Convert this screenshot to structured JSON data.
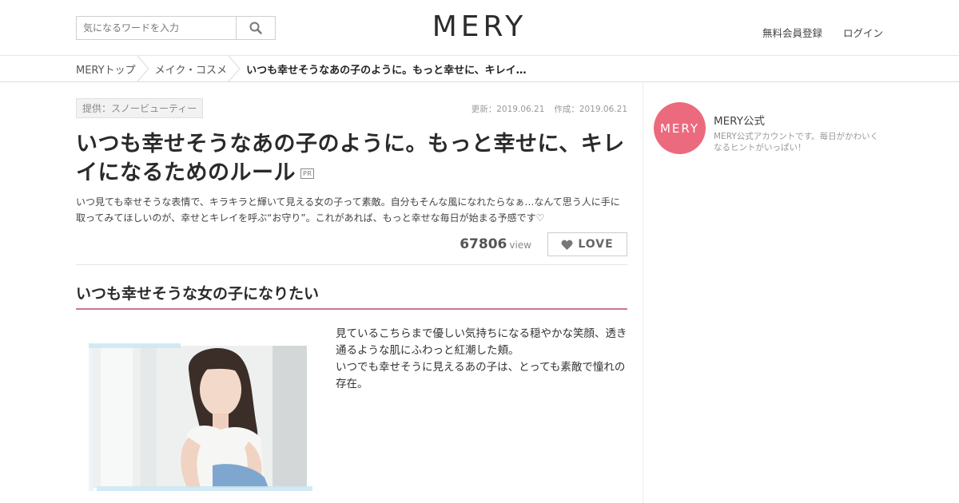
{
  "header": {
    "logo": "MERY",
    "search_placeholder": "気になるワードを入力",
    "register_label": "無料会員登録",
    "login_label": "ログイン"
  },
  "breadcrumb": {
    "items": [
      "MERYトップ",
      "メイク・コスメ",
      "いつも幸せそうなあの子のように。もっと幸せに、キレイ…"
    ]
  },
  "article": {
    "provider": "提供：スノービューティー",
    "updated": "更新：2019.06.21",
    "created": "作成：2019.06.21",
    "title": "いつも幸せそうなあの子のように。もっと幸せに、キレイになるためのルール",
    "pr_badge": "PR",
    "description": "いつ見ても幸せそうな表情で、キラキラと輝いて見える女の子って素敵。自分もそんな風になれたらなぁ…なんて思う人に手に取ってみてほしいのが、幸せとキレイを呼ぶ“お守り”。これがあれば、もっと幸せな毎日が始まる予感です♡",
    "views": "67806",
    "views_unit": "view",
    "love_label": "LOVE",
    "section_heading": "いつも幸せそうな女の子になりたい",
    "body_line1": "見ているこちらまで優しい気持ちになる穏やかな笑顔、透き通るような肌にふわっと紅潮した頬。",
    "body_line2": "いつでも幸せそうに見えるあの子は、とっても素敵で憧れの存在。"
  },
  "sidebar": {
    "avatar_text": "MERY",
    "name": "MERY公式",
    "description": "MERY公式アカウントです。毎日がかわいくなるヒントがいっぱい！",
    "avatar_color": "#ec6a7d"
  },
  "colors": {
    "accent": "#c9788c",
    "avatar": "#ec6a7d"
  }
}
